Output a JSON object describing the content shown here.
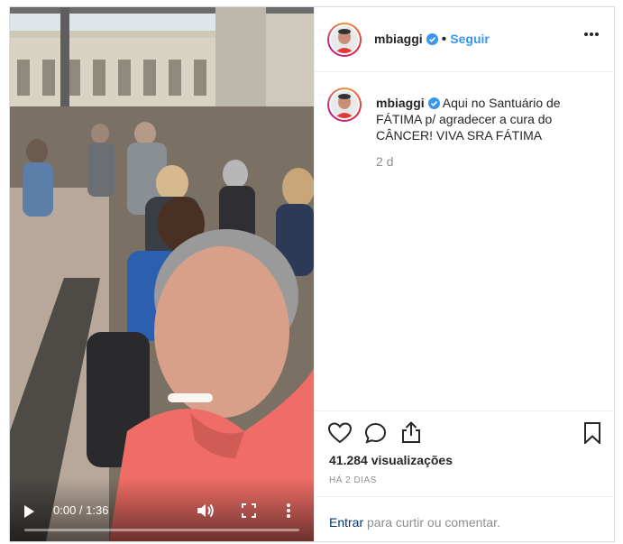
{
  "post": {
    "username": "mbiaggi",
    "follow_label": "Seguir",
    "caption": "Aqui no Santuário de FÁTIMA p/ agradecer a cura do CÂNCER! VIVA SRA FÁTIMA",
    "caption_age": "2 d",
    "views": "41.284 visualizações",
    "date": "HÁ 2 DIAS"
  },
  "video": {
    "time": "0:00 / 1:36",
    "progress": 0
  },
  "login_prompt": {
    "link": "Entrar",
    "text": " para curtir ou comentar."
  },
  "icons": [
    "verified-badge-icon",
    "more-options-icon",
    "heart-icon",
    "comment-icon",
    "share-icon",
    "bookmark-icon",
    "play-icon",
    "volume-icon",
    "fullscreen-icon",
    "video-menu-icon"
  ],
  "colors": {
    "accent": "#3897f0",
    "link": "#003569",
    "muted": "#8e8e8e"
  }
}
